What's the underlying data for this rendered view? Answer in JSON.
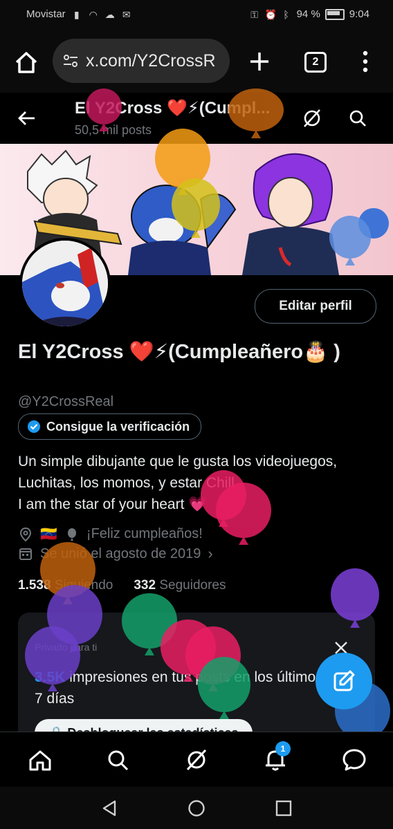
{
  "status_bar": {
    "carrier": "Movistar",
    "battery": "94 %",
    "time": "9:04"
  },
  "browser": {
    "url": "x.com/Y2CrossR",
    "tab_count": "2"
  },
  "profile_header": {
    "title": "El Y2Cross ❤️⚡(Cumpl...",
    "posts": "50,5 mil posts"
  },
  "profile": {
    "edit_label": "Editar perfil",
    "name": "El Y2Cross ❤️⚡(Cumpleañero🎂 )",
    "handle": "@Y2CrossReal",
    "verify_label": "Consigue la verificación",
    "bio_line1": "Un simple dibujante que le gusta los videojuegos,",
    "bio_line2": "Luchitas, los momos, y estar Chill",
    "bio_line3": "I am the star of your heart 💗",
    "location_flag": "🇻🇪",
    "birthday": "¡Feliz cumpleaños!",
    "joined": "Se unió el agosto de 2019",
    "following_count": "1.538",
    "following_label": "Siguiendo",
    "followers_count": "332",
    "followers_label": "Seguidores"
  },
  "card": {
    "private_label": "Privado para ti",
    "impressions_value": "3.5K",
    "impressions_text": " impresiones en tus posts en los últimos 7 días",
    "unlock_label": "Desbloquear las estadísticas"
  },
  "bottom_nav": {
    "notifications_badge": "1"
  },
  "colors": {
    "accent": "#1d9bf0",
    "background": "#000000",
    "muted": "#71767b"
  }
}
